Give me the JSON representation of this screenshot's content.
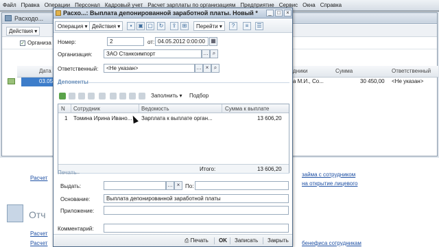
{
  "menu": [
    "Файл",
    "Правка",
    "Операции",
    "Персонал",
    "Кадровый учет",
    "Расчет зарплаты по организациям",
    "Предприятие",
    "Сервис",
    "Окна",
    "Справка"
  ],
  "background": {
    "window_title": "Расходо...",
    "actions_label": "Действия",
    "filter_label": "Организа",
    "columns": {
      "date": "Дата",
      "employee": "дники",
      "amount": "Сумма",
      "responsible": "Ответственный"
    },
    "row": {
      "date": "03.05",
      "employee": "а М.И., Со...",
      "amount": "30 450,00",
      "responsible": "<Не указан>"
    },
    "links": {
      "agreement": "займа с сотрудником",
      "account": "на открытие лицевого",
      "bottom_right": "бенефиса сотрудникам",
      "left1": "Расчет",
      "left2": "Расчет",
      "left3": "Расчет"
    },
    "reports_label": "Отч"
  },
  "doc": {
    "title": "Расхо...: Выплата депонированной заработной платы. Новый *",
    "toolbar": {
      "operation": "Операция",
      "actions": "Действия",
      "goto": "Перейти"
    },
    "fields": {
      "number_label": "Номер:",
      "number_value": "2",
      "date_label": "от:",
      "date_value": "04.05.2012  0:00:00",
      "org_label": "Организация:",
      "org_value": "ЗАО Станкоимпорт",
      "resp_label": "Ответственный:",
      "resp_value": "<Не указан>"
    },
    "deponents_section": "Депоненты",
    "table_toolbar": {
      "fill": "Заполнить",
      "select": "Подбор"
    },
    "table": {
      "headers": {
        "num": "N",
        "employee": "Сотрудник",
        "statement": "Ведомость",
        "amount": "Сумма к выплате"
      },
      "rows": [
        {
          "num": "1",
          "employee": "Томина Ирина Ивано...",
          "statement": "Зарплата к выплате орган...",
          "amount": "13 606,20"
        }
      ],
      "total_label": "Итого:",
      "total_value": "13 606,20"
    },
    "print_section": "Печать",
    "print": {
      "issue_label": "Выдать:",
      "issue_value": "",
      "by_label": "По:",
      "by_value": "",
      "basis_label": "Основание:",
      "basis_value": "Выплата депонированной заработной платы",
      "attachment_label": "Приложение:",
      "attachment_value": "",
      "comment_label": "Комментарий:",
      "comment_value": ""
    },
    "footer": {
      "print": "Печать",
      "ok": "OK",
      "save": "Записать",
      "close": "Закрыть"
    }
  }
}
